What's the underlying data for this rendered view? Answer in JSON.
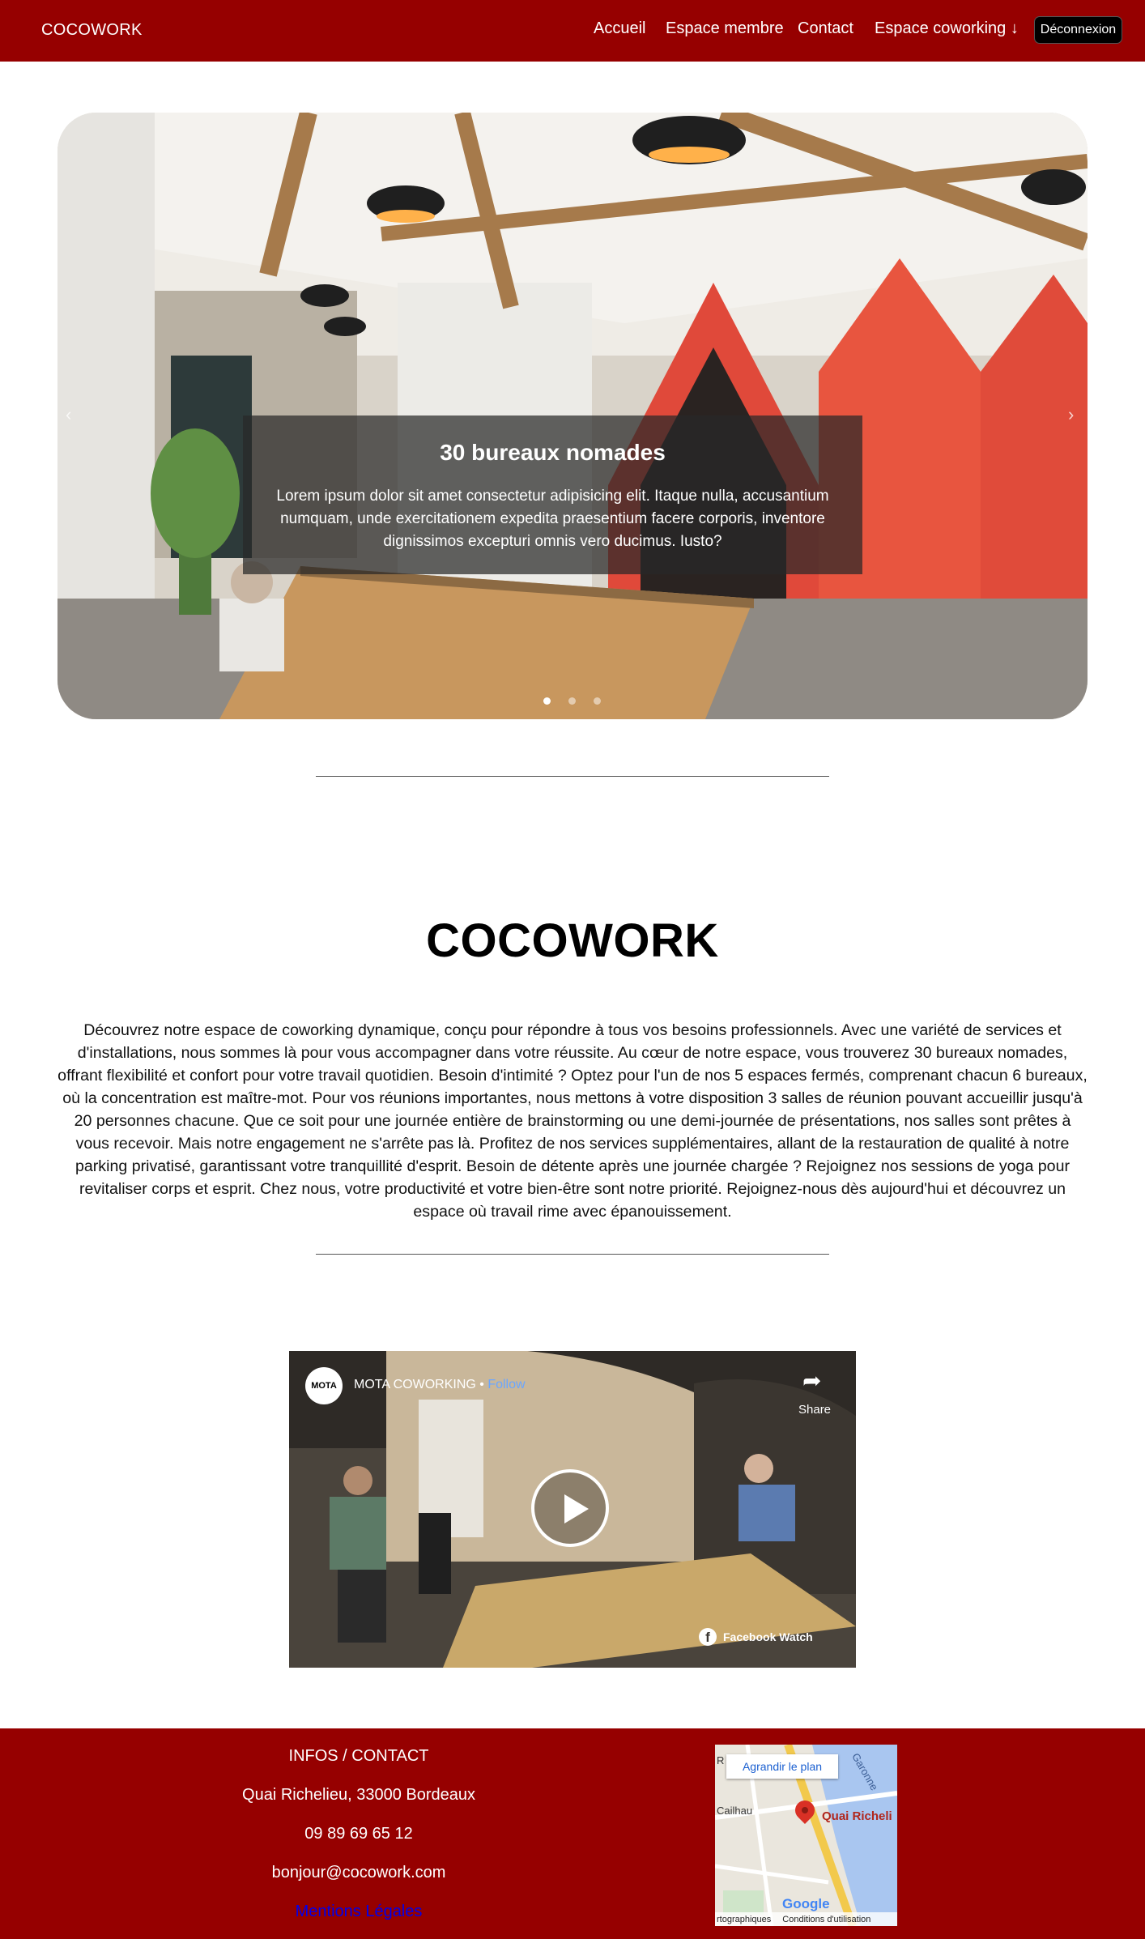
{
  "nav": {
    "brand": "COCOWORK",
    "items": [
      "Accueil",
      "Espace membre",
      "Contact",
      "Espace coworking ↓"
    ],
    "logout": "Déconnexion",
    "bg_color": "#960000"
  },
  "carousel": {
    "caption_title": "30 bureaux nomades",
    "caption_text": "Lorem ipsum dolor sit amet consectetur adipisicing elit. Itaque nulla, accusantium numquam, unde exercitationem expedita praesentium facere corporis, inventore dignissimos excepturi omnis vero ducimus. Iusto?",
    "prev_icon": "chevron-left-icon",
    "next_icon": "chevron-right-icon",
    "slide_count": 3,
    "active_slide": 1
  },
  "intro": {
    "title": "COCOWORK",
    "description": "Découvrez notre espace de coworking dynamique, conçu pour répondre à tous vos besoins professionnels. Avec une variété de services et d'installations, nous sommes là pour vous accompagner dans votre réussite. Au cœur de notre espace, vous trouverez 30 bureaux nomades, offrant flexibilité et confort pour votre travail quotidien. Besoin d'intimité ? Optez pour l'un de nos 5 espaces fermés, comprenant chacun 6 bureaux, où la concentration est maître-mot. Pour vos réunions importantes, nous mettons à votre disposition 3 salles de réunion pouvant accueillir jusqu'à 20 personnes chacune. Que ce soit pour une journée entière de brainstorming ou une demi-journée de présentations, nos salles sont prêtes à vous recevoir. Mais notre engagement ne s'arrête pas là. Profitez de nos services supplémentaires, allant de la restauration de qualité à notre parking privatisé, garantissant votre tranquillité d'esprit. Besoin de détente après une journée chargée ? Rejoignez nos sessions de yoga pour revitaliser corps et esprit. Chez nous, votre productivité et votre bien-être sont notre priorité. Rejoignez-nous dès aujourd'hui et découvrez un espace où travail rime avec épanouissement."
  },
  "video": {
    "channel_logo": "MOTA",
    "channel": "MOTA COWORKING",
    "separator": " • ",
    "follow": "Follow",
    "share": "Share",
    "watch_label": "Facebook Watch",
    "fb_glyph": "f"
  },
  "footer": {
    "heading": "INFOS / CONTACT",
    "address": "Quai Richelieu, 33000 Bordeaux",
    "phone": "09 89 69 65 12",
    "email": "bonjour@cocowork.com",
    "legal": "Mentions Légales",
    "map": {
      "enlarge": "Agrandir le plan",
      "label_r": "R",
      "label_garonne": "Garonne",
      "label_cailhau": "Cailhau",
      "place": "Quai Richeli",
      "logo": "Google",
      "credits": "rtographiques",
      "terms": "Conditions d'utilisation"
    }
  }
}
